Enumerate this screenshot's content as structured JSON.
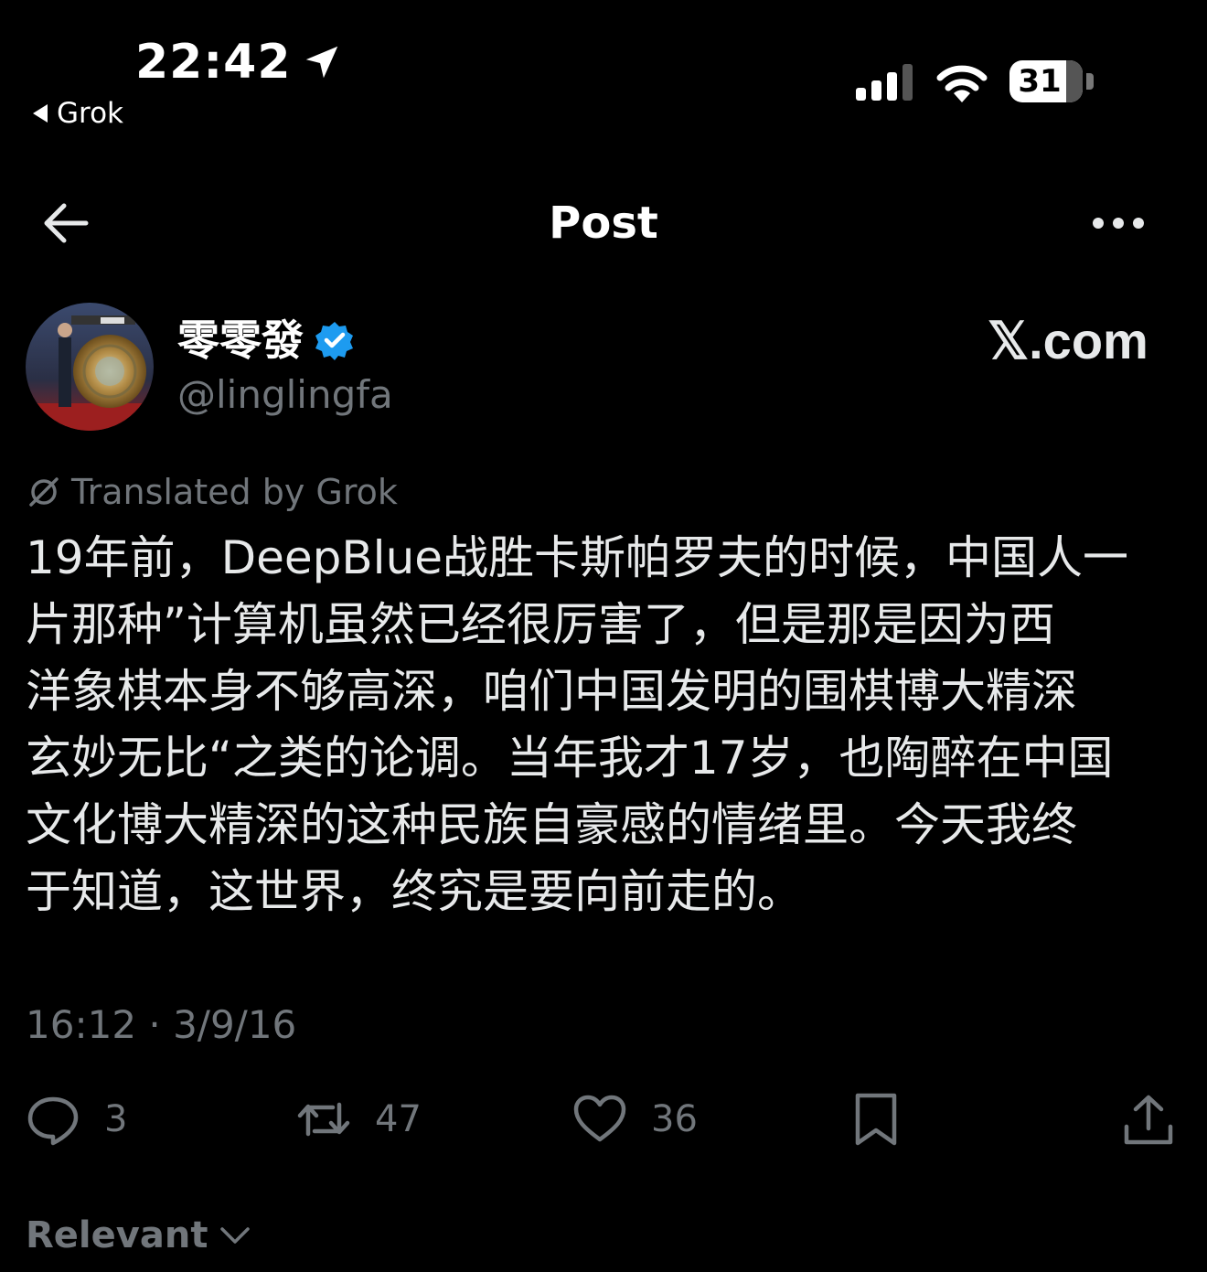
{
  "status_bar": {
    "time": "22:42",
    "back_app": "Grok",
    "battery": "31"
  },
  "nav": {
    "title": "Post"
  },
  "author": {
    "name": "零零發",
    "handle": "@linglingfa",
    "verified": true
  },
  "watermark": "𝕏.com",
  "translation_note": "Translated by Grok",
  "post": {
    "text": "19年前，DeepBlue战胜卡斯帕罗夫的时候，中国人一\n片那种”计算机虽然已经很厉害了，但是那是因为西\n洋象棋本身不够高深，咱们中国发明的围棋博大精深\n玄妙无比“之类的论调。当年我才17岁，也陶醉在中国\n文化博大精深的这种民族自豪感的情绪里。今天我终\n于知道，这世界，终究是要向前走的。",
    "timestamp": "16:12 · 3/9/16"
  },
  "actions": {
    "replies": "3",
    "reposts": "47",
    "likes": "36"
  },
  "sort": {
    "label": "Relevant"
  },
  "colors": {
    "background": "#000000",
    "text": "#e7e9ea",
    "muted": "#71767b",
    "verified": "#1d9bf0"
  }
}
